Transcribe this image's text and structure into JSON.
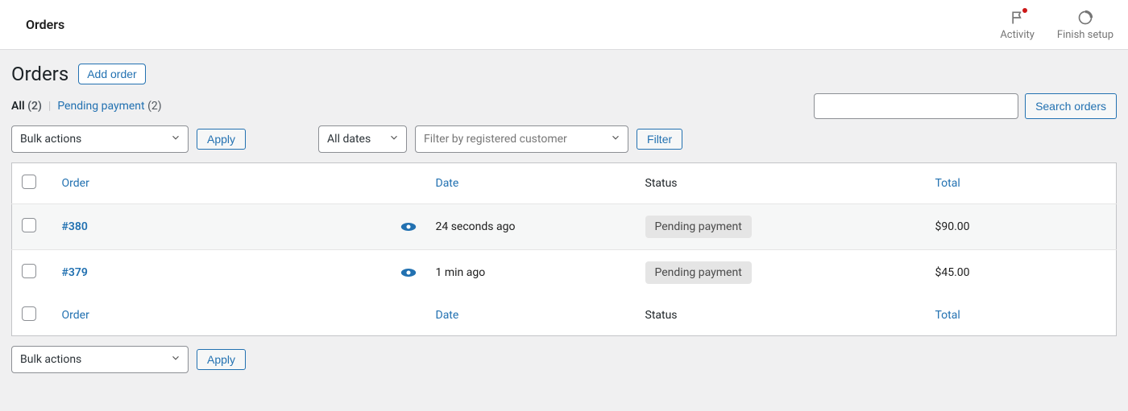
{
  "top_bar": {
    "title": "Orders",
    "activity_label": "Activity",
    "finish_label": "Finish setup"
  },
  "heading": {
    "title": "Orders",
    "add_button": "Add order"
  },
  "status_filters": {
    "all_label": "All",
    "all_count": "(2)",
    "pending_label": "Pending payment",
    "pending_count": "(2)"
  },
  "search": {
    "button": "Search orders"
  },
  "controls": {
    "bulk_actions": "Bulk actions",
    "apply": "Apply",
    "all_dates": "All dates",
    "customer_placeholder": "Filter by registered customer",
    "filter": "Filter"
  },
  "table": {
    "headers": {
      "order": "Order",
      "date": "Date",
      "status": "Status",
      "total": "Total"
    },
    "rows": [
      {
        "id": "#380",
        "date": "24 seconds ago",
        "status": "Pending payment",
        "total": "$90.00"
      },
      {
        "id": "#379",
        "date": "1 min ago",
        "status": "Pending payment",
        "total": "$45.00"
      }
    ]
  }
}
